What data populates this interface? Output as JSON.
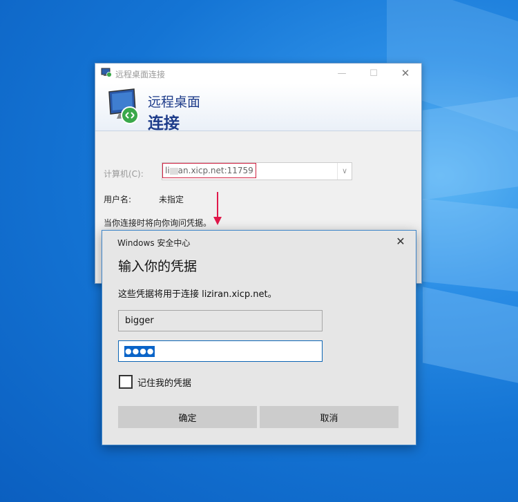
{
  "rdp_window": {
    "title": "远程桌面连接",
    "header_line1": "远程桌面",
    "header_line2": "连接",
    "computer_label": "计算机(C):",
    "computer_value_prefix": "li",
    "computer_value_suffix": "an.xicp.net:11759",
    "username_label": "用户名:",
    "username_value": "未指定",
    "credentials_info": "当你连接时将向你询问凭据。"
  },
  "security_dialog": {
    "title": "Windows 安全中心",
    "heading": "输入你的凭据",
    "description": "这些凭据将用于连接 liziran.xicp.net。",
    "username_value": "bigger",
    "password_mask": "●●●●",
    "remember_label": "记住我的凭据",
    "ok_label": "确定",
    "cancel_label": "取消"
  },
  "icons": [
    "remote-desktop-app-icon",
    "minimize-icon",
    "maximize-icon",
    "close-icon",
    "remote-desktop-monitor-icon",
    "dropdown-chevron-icon",
    "red-arrow-icon"
  ],
  "colors": {
    "accent": "#0a64c8",
    "header_text": "#1e3c8a",
    "highlight_red": "#d02040",
    "arrow": "#e0184a"
  }
}
